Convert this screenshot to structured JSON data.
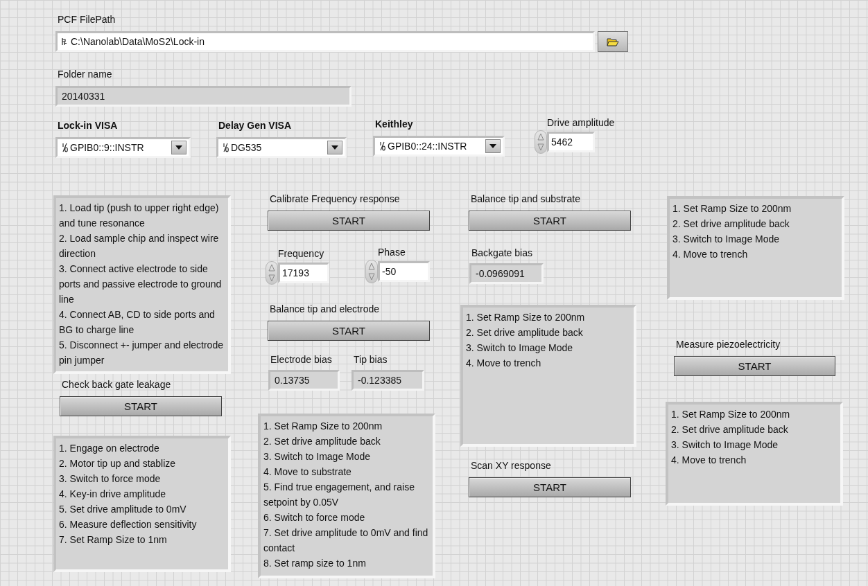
{
  "controls": [
    {
      "kind": "path",
      "label": "PCF FilePath",
      "value": "C:\\Nanolab\\Data\\MoS2\\Lock-in"
    },
    {
      "kind": "string_indicator",
      "label": "Folder name",
      "value": "20140331"
    },
    {
      "kind": "visa",
      "label": "Lock-in VISA",
      "value": "GPIB0::9::INSTR"
    },
    {
      "kind": "visa",
      "label": "Delay Gen VISA",
      "value": "DG535"
    },
    {
      "kind": "visa",
      "label": "Keithley",
      "value": "GPIB0::24::INSTR"
    },
    {
      "kind": "numeric",
      "label": "Drive amplitude",
      "value": "5462"
    },
    {
      "kind": "instructions",
      "lines": [
        "1. Load tip (push to upper right edge) and tune resonance",
        "2. Load sample chip and inspect wire direction",
        "3. Connect active electrode to side ports and passive electrode to ground line",
        "4. Connect AB, CD to side ports and BG to charge line",
        "5. Disconnect +- jumper and electrode pin jumper"
      ]
    },
    {
      "kind": "button",
      "label": "Calibrate Frequency response",
      "text": "START"
    },
    {
      "kind": "button",
      "label": "Balance tip and substrate",
      "text": "START"
    },
    {
      "kind": "instructions",
      "lines": [
        "1. Set Ramp Size to 200nm",
        "2. Set drive amplitude back",
        "3. Switch to Image Mode",
        "4. Move to trench"
      ]
    },
    {
      "kind": "numeric",
      "label": "Frequency",
      "value": "17193"
    },
    {
      "kind": "numeric",
      "label": "Phase",
      "value": "-50"
    },
    {
      "kind": "numeric_indicator",
      "label": "Backgate bias",
      "value": "-0.0969091"
    },
    {
      "kind": "button",
      "label": "Balance tip and electrode",
      "text": "START"
    },
    {
      "kind": "instructions",
      "lines": [
        "1. Set Ramp Size to 200nm",
        "2. Set drive amplitude back",
        "3. Switch to Image Mode",
        "4. Move to trench"
      ]
    },
    {
      "kind": "numeric_indicator",
      "label": "Electrode bias",
      "value": "0.13735"
    },
    {
      "kind": "numeric_indicator",
      "label": "Tip bias",
      "value": "-0.123385"
    },
    {
      "kind": "button",
      "label": "Measure piezoelectricity",
      "text": "START"
    },
    {
      "kind": "button",
      "label": "Check back gate leakage",
      "text": "START"
    },
    {
      "kind": "instructions",
      "lines": [
        "1. Set Ramp Size to 200nm",
        "2. Set drive amplitude back",
        "3. Switch to Image Mode",
        "4. Move to trench"
      ]
    },
    {
      "kind": "instructions",
      "lines": [
        "1. Engage on electrode",
        "2. Motor tip up and stablize",
        "3. Switch to force mode",
        "4. Key-in drive amplitude",
        "5. Set drive amplitude to 0mV",
        "6. Measure deflection sensitivity",
        "7. Set Ramp Size to 1nm"
      ]
    },
    {
      "kind": "instructions",
      "lines": [
        "1. Set Ramp Size to 200nm",
        "2. Set drive amplitude back",
        "3. Switch to Image Mode",
        "4. Move to substrate",
        "5. Find true engagement, and raise setpoint by 0.05V",
        "6. Switch to force mode",
        "7. Set drive amplitude to 0mV and find contact",
        "8. Set ramp size to 1nm"
      ]
    },
    {
      "kind": "button",
      "label": "Scan XY response",
      "text": "START"
    }
  ]
}
